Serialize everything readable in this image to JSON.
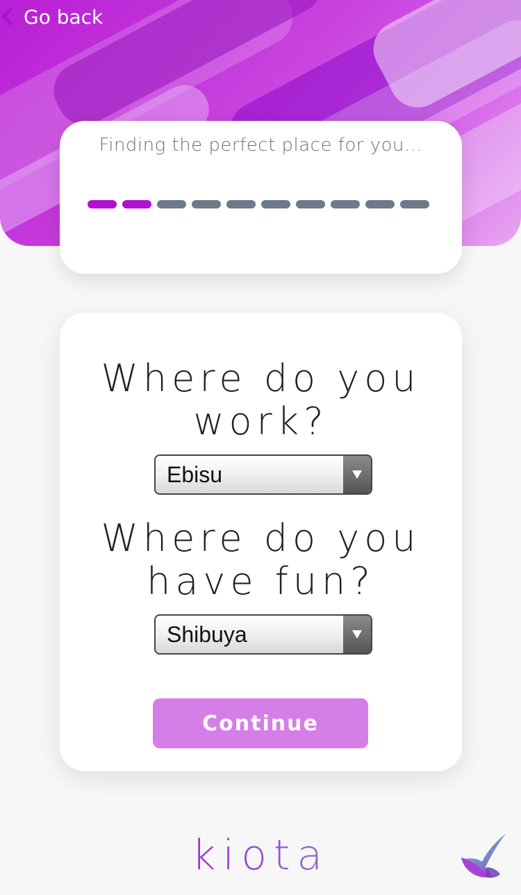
{
  "nav": {
    "back_label": "Go back"
  },
  "progress": {
    "title": "Finding the perfect place for you...",
    "total_steps": 10,
    "completed_steps": 2
  },
  "form": {
    "work_question": "Where do you work?",
    "work_value": "Ebisu",
    "fun_question": "Where do you have fun?",
    "fun_value": "Shibuya",
    "continue_label": "Continue"
  },
  "footer": {
    "logo_text": "kiota"
  },
  "colors": {
    "accent": "#b10fd1",
    "step_pending": "#6c7a89",
    "button": "#d67ee8"
  },
  "icons": {
    "back": "chevron-left-icon",
    "dropdown": "triangle-down-icon",
    "logo": "kiota-logo-icon"
  }
}
